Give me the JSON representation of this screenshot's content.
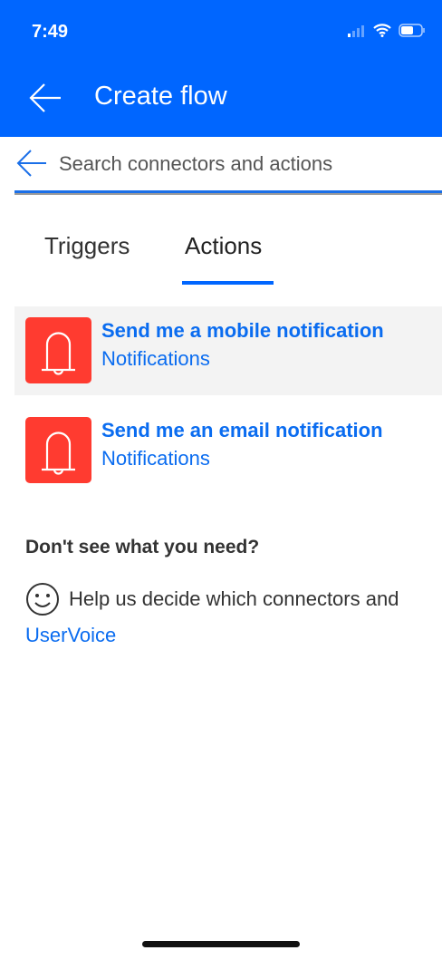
{
  "status_bar": {
    "time": "7:49"
  },
  "header": {
    "title": "Create flow"
  },
  "search": {
    "placeholder": "Search connectors and actions"
  },
  "tabs": [
    {
      "label": "Triggers",
      "active": false
    },
    {
      "label": "Actions",
      "active": true
    }
  ],
  "items": [
    {
      "title": "Send me a mobile notification",
      "subtitle": "Notifications",
      "icon": "bell-icon"
    },
    {
      "title": "Send me an email notification",
      "subtitle": "Notifications",
      "icon": "bell-icon"
    }
  ],
  "feedback": {
    "heading": "Don't see what you need?",
    "text": "Help us decide which connectors and",
    "link": "UserVoice"
  },
  "colors": {
    "brand": "#0066ff",
    "icon_bg": "#ff3b30",
    "link": "#0a6cf0"
  }
}
